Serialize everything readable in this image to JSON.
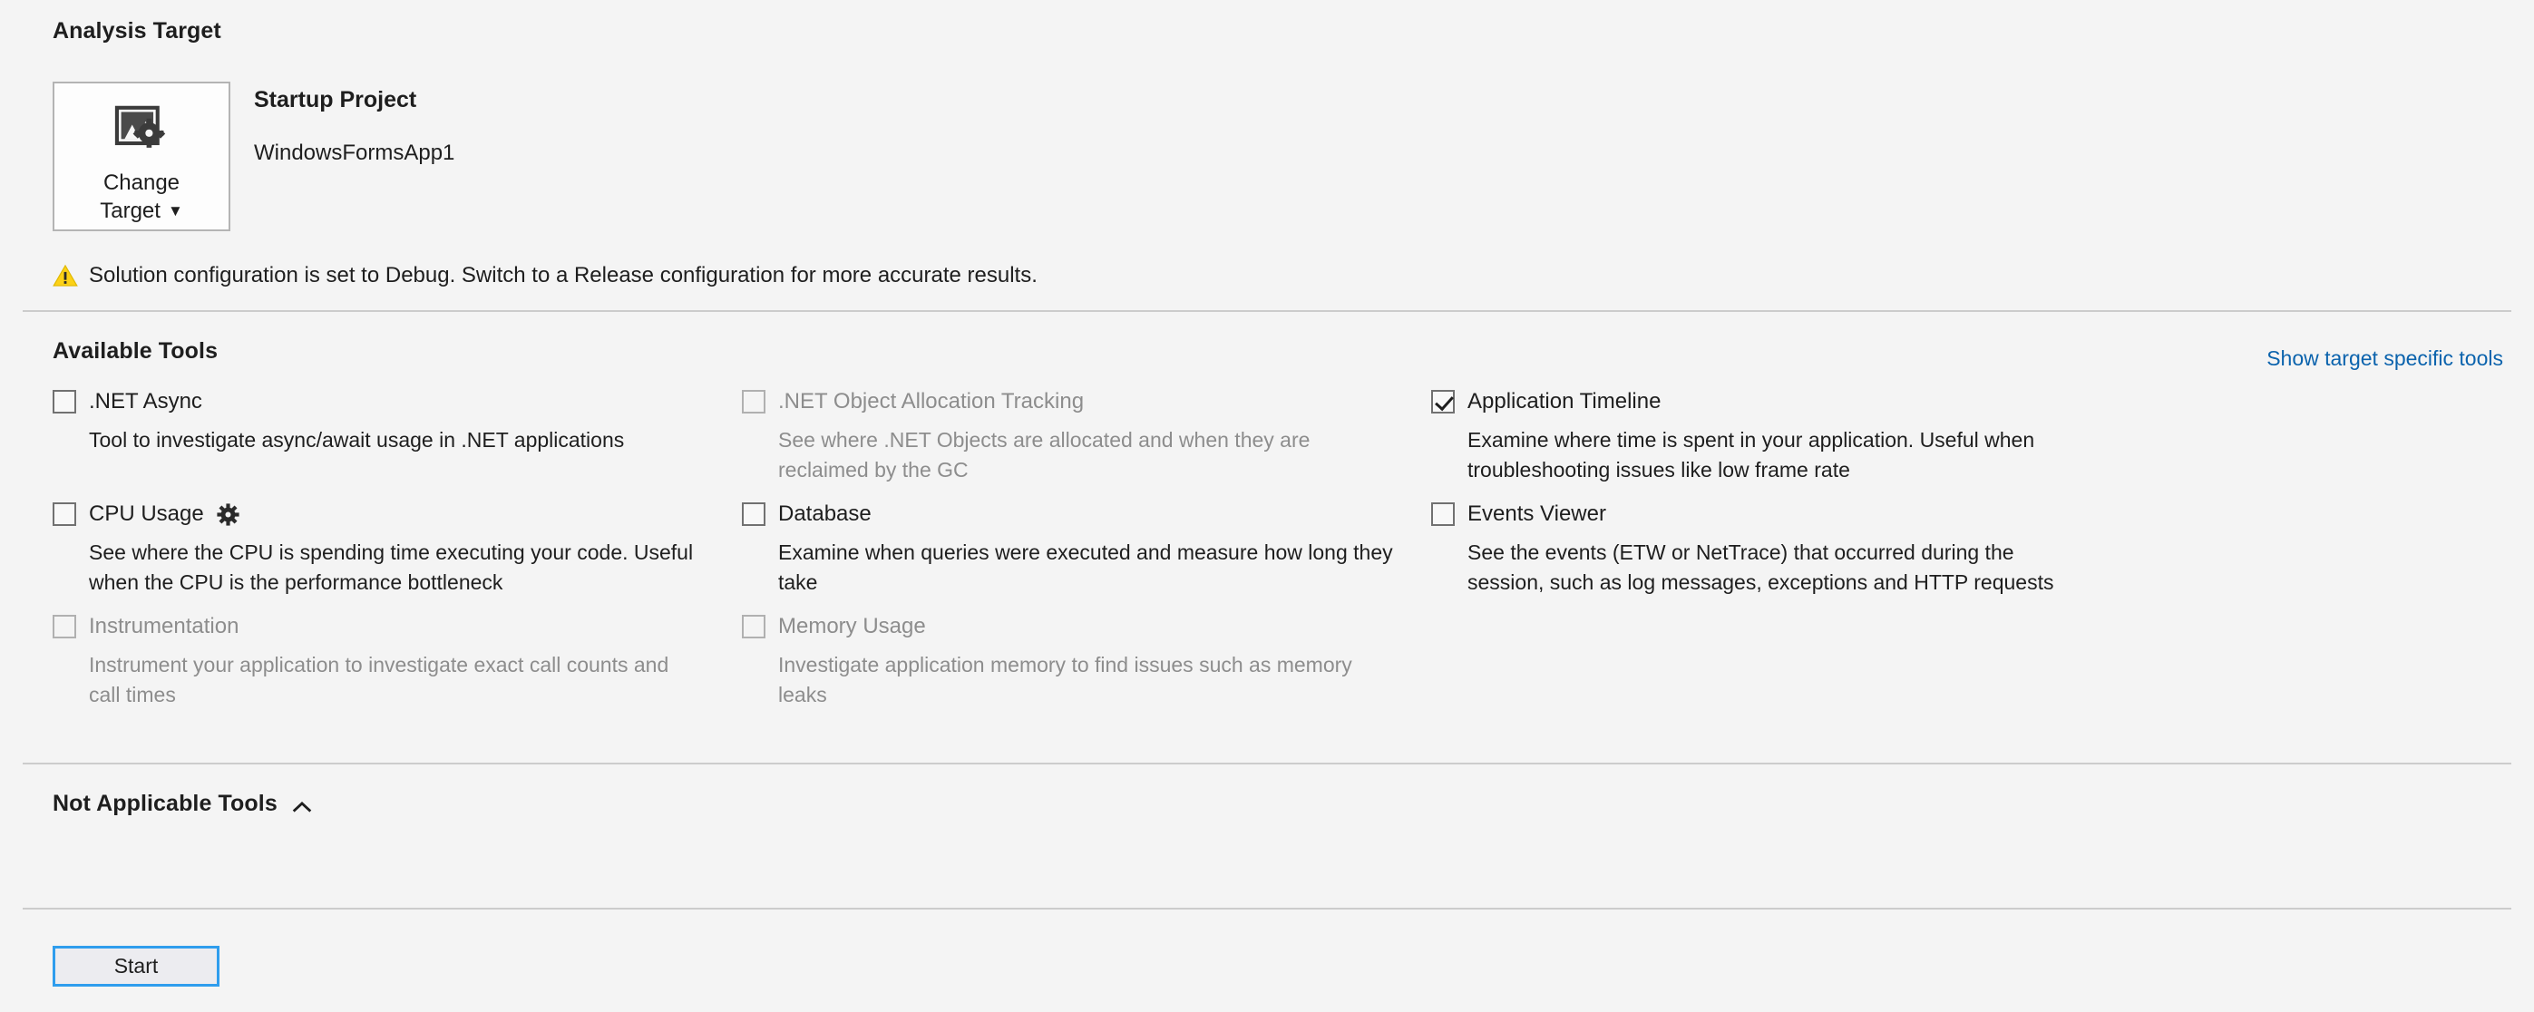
{
  "analysis_target": {
    "section_title": "Analysis Target",
    "change_target_button": {
      "line1": "Change",
      "line2": "Target",
      "icon": "image-settings-icon",
      "caret": "▼"
    },
    "startup_project_label": "Startup Project",
    "project_name": "WindowsFormsApp1",
    "warning": {
      "icon": "warning-triangle-icon",
      "text": "Solution configuration is set to Debug. Switch to a Release configuration for more accurate results."
    }
  },
  "available_tools": {
    "section_title": "Available Tools",
    "show_target_specific_tools": "Show target specific tools",
    "tools": [
      {
        "name": ".NET Async",
        "description": "Tool to investigate async/await usage in .NET applications",
        "checked": false,
        "disabled": false,
        "has_settings_gear": false,
        "column": 1
      },
      {
        "name": ".NET Object Allocation Tracking",
        "description": "See where .NET Objects are allocated and when they are reclaimed by the GC",
        "checked": false,
        "disabled": true,
        "has_settings_gear": false,
        "column": 2
      },
      {
        "name": "Application Timeline",
        "description": "Examine where time is spent in your application. Useful when troubleshooting issues like low frame rate",
        "checked": true,
        "disabled": false,
        "has_settings_gear": false,
        "column": 3
      },
      {
        "name": "CPU Usage",
        "description": "See where the CPU is spending time executing your code. Useful when the CPU is the performance bottleneck",
        "checked": false,
        "disabled": false,
        "has_settings_gear": true,
        "column": 1
      },
      {
        "name": "Database",
        "description": "Examine when queries were executed and measure how long they take",
        "checked": false,
        "disabled": false,
        "has_settings_gear": false,
        "column": 2
      },
      {
        "name": "Events Viewer",
        "description": "See the events (ETW or NetTrace) that occurred during the session, such as log messages, exceptions and HTTP requests",
        "checked": false,
        "disabled": false,
        "has_settings_gear": false,
        "column": 3
      },
      {
        "name": "Instrumentation",
        "description": "Instrument your application to investigate exact call counts and call times",
        "checked": false,
        "disabled": true,
        "has_settings_gear": false,
        "column": 1
      },
      {
        "name": "Memory Usage",
        "description": "Investigate application memory to find issues such as memory leaks",
        "checked": false,
        "disabled": true,
        "has_settings_gear": false,
        "column": 2
      }
    ]
  },
  "not_applicable_tools": {
    "section_title": "Not Applicable Tools",
    "caret": "⌃"
  },
  "footer": {
    "start_label": "Start"
  },
  "colors": {
    "background": "#f4f4f4",
    "link": "#0b63ad",
    "focus_border": "#2f9ded",
    "divider": "#cccccc",
    "disabled_text": "#8d8d8d",
    "warning_yellow": "#fcd116"
  }
}
